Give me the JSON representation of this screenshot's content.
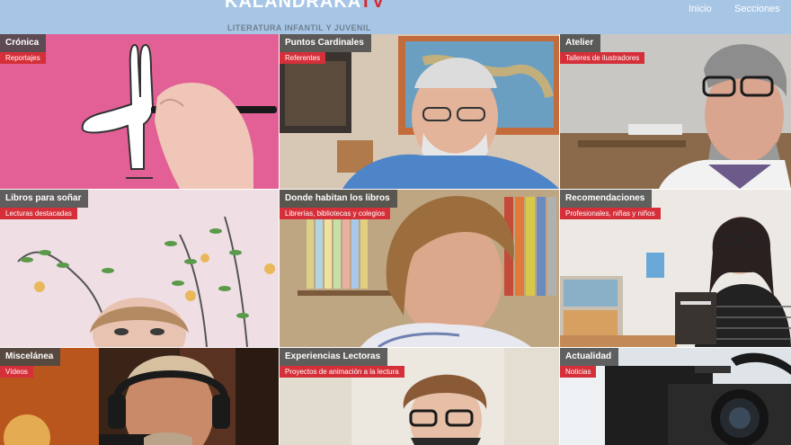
{
  "header": {
    "logo_main": "KALANDRAKA",
    "logo_suffix": "TV",
    "tagline": "LITERATURA INFANTIL Y JUVENIL",
    "nav": [
      "Inicio",
      "Secciones"
    ]
  },
  "colors": {
    "header_bg": "#a7c6e6",
    "label_dark": "#464646",
    "label_red": "#d5303a"
  },
  "tiles": [
    {
      "title": "Crónica",
      "subtitle": "Reportajes"
    },
    {
      "title": "Puntos Cardinales",
      "subtitle": "Referentes"
    },
    {
      "title": "Atelier",
      "subtitle": "Talleres de ilustradores"
    },
    {
      "title": "Libros para soñar",
      "subtitle": "Lecturas destacadas"
    },
    {
      "title": "Donde habitan los libros",
      "subtitle": "Librerías, bibliotecas y colegios"
    },
    {
      "title": "Recomendaciones",
      "subtitle": "Profesionales, niñas y niños"
    },
    {
      "title": "Miscelánea",
      "subtitle": "Vídeos"
    },
    {
      "title": "Experiencias Lectoras",
      "subtitle": "Proyectos de animación a la lectura"
    },
    {
      "title": "Actualidad",
      "subtitle": "Noticias"
    }
  ]
}
